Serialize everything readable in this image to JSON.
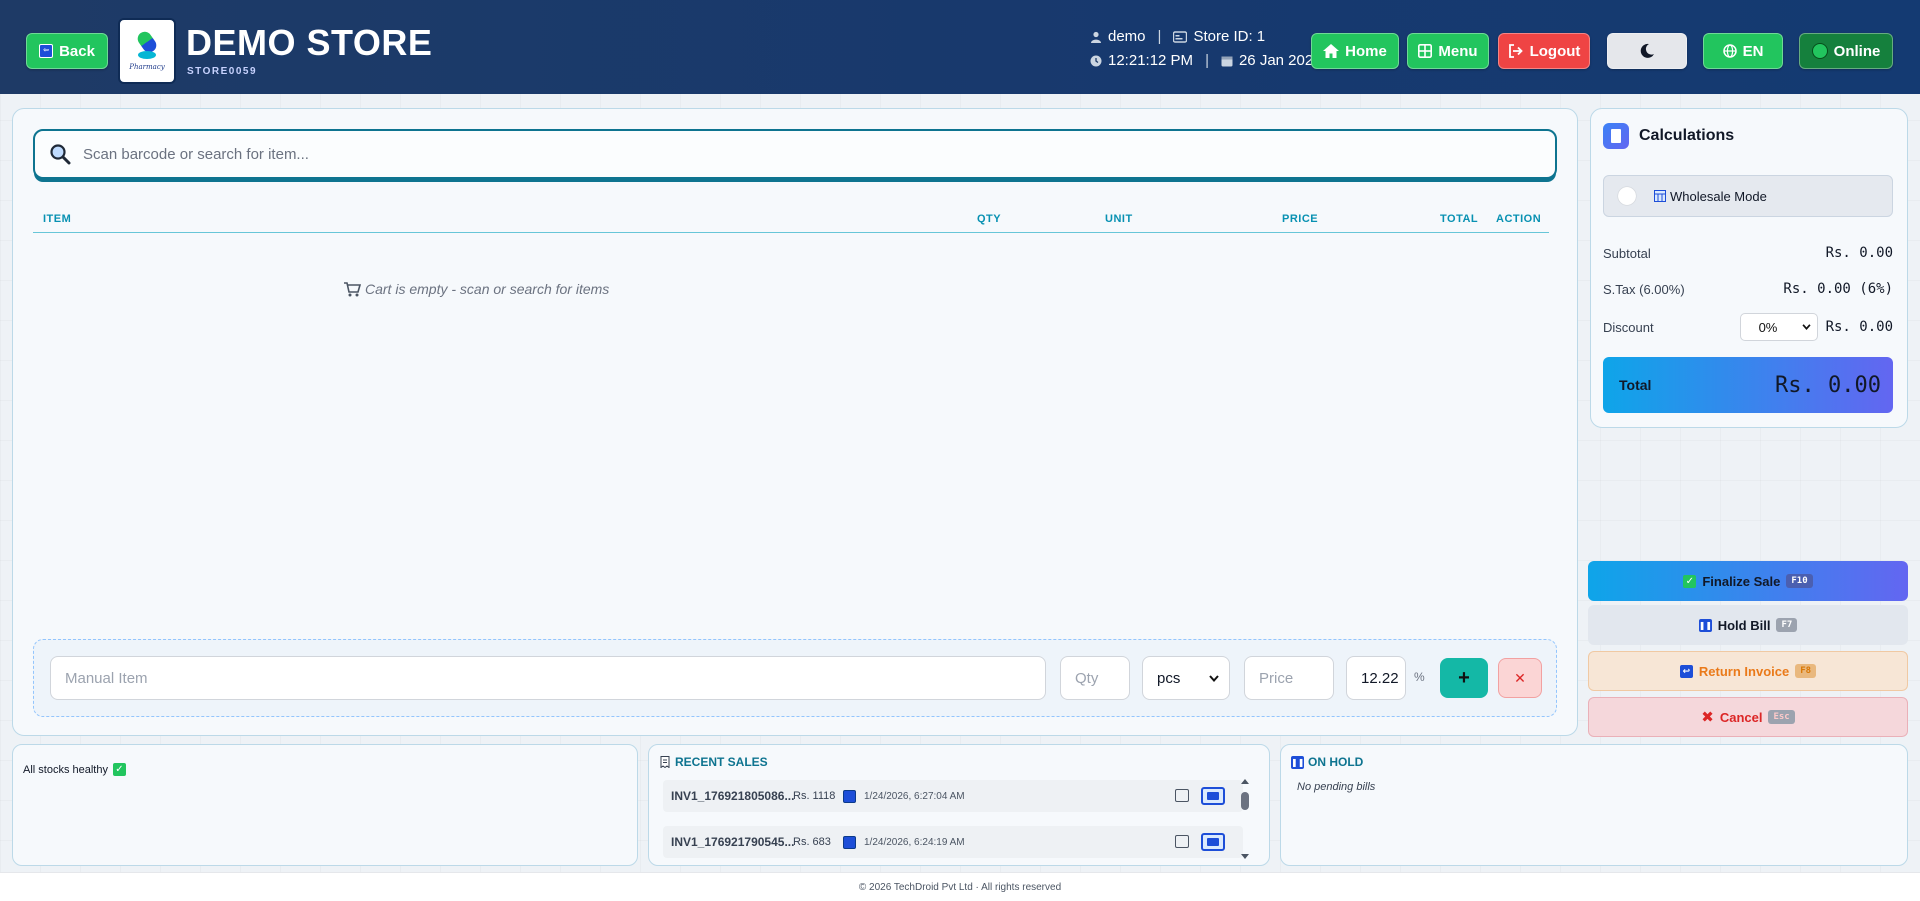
{
  "header": {
    "back_label": "Back",
    "store_name": "DEMO STORE",
    "store_code": "STORE0059",
    "logo_text": "Pharmacy",
    "user": "demo",
    "store_id_label": "Store ID: 1",
    "time": "12:21:12 PM",
    "date": "26 Jan 2026",
    "home_label": "Home",
    "menu_label": "Menu",
    "logout_label": "Logout",
    "language_label": "EN",
    "status_label": "Online"
  },
  "search": {
    "placeholder": "Scan barcode or search for item..."
  },
  "cart": {
    "columns": {
      "item": "ITEM",
      "qty": "QTY",
      "unit": "UNIT",
      "price": "PRICE",
      "total": "TOTAL",
      "action": "ACTION"
    },
    "empty_message": "Cart is empty - scan or search for items"
  },
  "manual_item": {
    "name_placeholder": "Manual Item",
    "qty_placeholder": "Qty",
    "unit_selected": "pcs",
    "price_placeholder": "Price",
    "tax_value": "12.22",
    "tax_suffix": "%",
    "add_label": "+",
    "clear_label": "✕"
  },
  "calculations": {
    "title": "Calculations",
    "wholesale_label": "Wholesale Mode",
    "subtotal_label": "Subtotal",
    "subtotal_value": "Rs. 0.00",
    "tax_label": "S.Tax (6.00%)",
    "tax_value": "Rs. 0.00 (6%)",
    "discount_label": "Discount",
    "discount_selected": "0%",
    "discount_value": "Rs. 0.00",
    "total_label": "Total",
    "total_value": "Rs. 0.00"
  },
  "actions": {
    "finalize_label": "Finalize Sale",
    "finalize_key": "F10",
    "hold_label": "Hold Bill",
    "hold_key": "F7",
    "return_label": "Return Invoice",
    "return_key": "F8",
    "cancel_label": "Cancel",
    "cancel_key": "Esc"
  },
  "stock": {
    "message": "All stocks healthy"
  },
  "recent_sales": {
    "title": "RECENT SALES",
    "rows": [
      {
        "invoice": "INV1_176921805086...",
        "amount": "Rs. 1118",
        "datetime": "1/24/2026, 6:27:04 AM"
      },
      {
        "invoice": "INV1_176921790545...",
        "amount": "Rs. 683",
        "datetime": "1/24/2026, 6:24:19 AM"
      }
    ]
  },
  "on_hold": {
    "title": "ON HOLD",
    "empty_message": "No pending bills"
  },
  "footer": {
    "text": "© 2026 TechDroid Pvt Ltd · All rights reserved"
  },
  "colors": {
    "header_bg": "#1e3a66",
    "accent_green": "#22c55e",
    "accent_red": "#ef4444",
    "accent_teal": "#0e7490",
    "total_gradient_start": "#0ea5e9",
    "total_gradient_end": "#6366f1"
  }
}
